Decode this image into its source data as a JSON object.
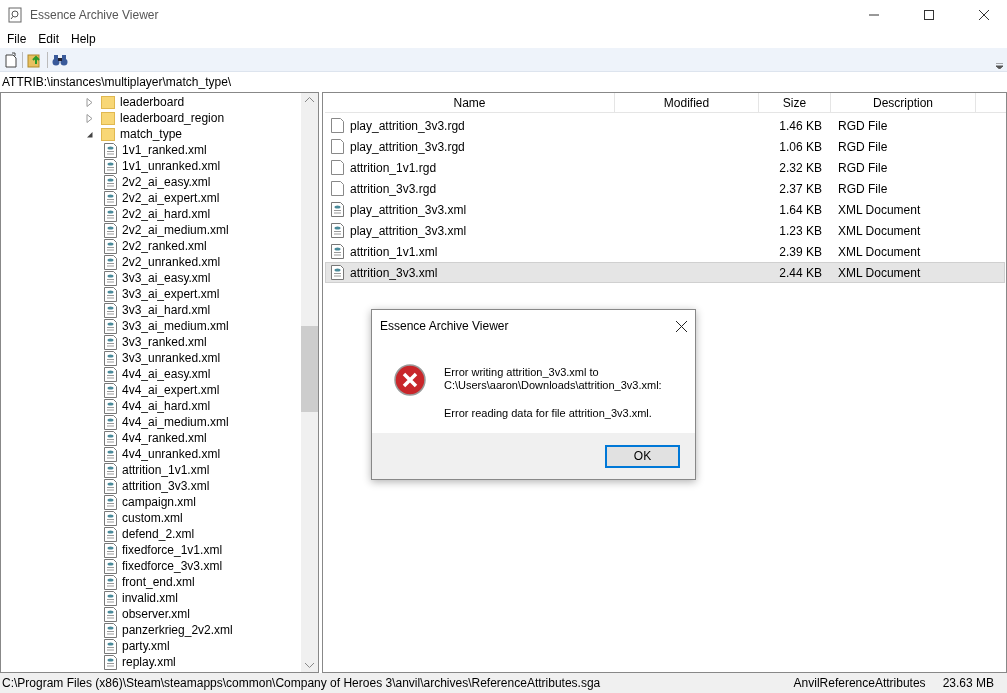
{
  "window": {
    "title": "Essence Archive Viewer"
  },
  "menu": [
    "File",
    "Edit",
    "Help"
  ],
  "address": "ATTRIB:\\instances\\multiplayer\\match_type\\",
  "tree": [
    {
      "label": "leaderboard",
      "kind": "folder",
      "expanded": false
    },
    {
      "label": "leaderboard_region",
      "kind": "folder",
      "expanded": false
    },
    {
      "label": "match_type",
      "kind": "folder",
      "expanded": true,
      "children": [
        {
          "label": "1v1_ranked.xml",
          "kind": "file"
        },
        {
          "label": "1v1_unranked.xml",
          "kind": "file"
        },
        {
          "label": "2v2_ai_easy.xml",
          "kind": "file"
        },
        {
          "label": "2v2_ai_expert.xml",
          "kind": "file"
        },
        {
          "label": "2v2_ai_hard.xml",
          "kind": "file"
        },
        {
          "label": "2v2_ai_medium.xml",
          "kind": "file"
        },
        {
          "label": "2v2_ranked.xml",
          "kind": "file"
        },
        {
          "label": "2v2_unranked.xml",
          "kind": "file"
        },
        {
          "label": "3v3_ai_easy.xml",
          "kind": "file"
        },
        {
          "label": "3v3_ai_expert.xml",
          "kind": "file"
        },
        {
          "label": "3v3_ai_hard.xml",
          "kind": "file"
        },
        {
          "label": "3v3_ai_medium.xml",
          "kind": "file"
        },
        {
          "label": "3v3_ranked.xml",
          "kind": "file"
        },
        {
          "label": "3v3_unranked.xml",
          "kind": "file"
        },
        {
          "label": "4v4_ai_easy.xml",
          "kind": "file"
        },
        {
          "label": "4v4_ai_expert.xml",
          "kind": "file"
        },
        {
          "label": "4v4_ai_hard.xml",
          "kind": "file"
        },
        {
          "label": "4v4_ai_medium.xml",
          "kind": "file"
        },
        {
          "label": "4v4_ranked.xml",
          "kind": "file"
        },
        {
          "label": "4v4_unranked.xml",
          "kind": "file"
        },
        {
          "label": "attrition_1v1.xml",
          "kind": "file"
        },
        {
          "label": "attrition_3v3.xml",
          "kind": "file"
        },
        {
          "label": "campaign.xml",
          "kind": "file"
        },
        {
          "label": "custom.xml",
          "kind": "file"
        },
        {
          "label": "defend_2.xml",
          "kind": "file"
        },
        {
          "label": "fixedforce_1v1.xml",
          "kind": "file"
        },
        {
          "label": "fixedforce_3v3.xml",
          "kind": "file"
        },
        {
          "label": "front_end.xml",
          "kind": "file"
        },
        {
          "label": "invalid.xml",
          "kind": "file"
        },
        {
          "label": "observer.xml",
          "kind": "file"
        },
        {
          "label": "panzerkrieg_2v2.xml",
          "kind": "file"
        },
        {
          "label": "party.xml",
          "kind": "file"
        },
        {
          "label": "replay.xml",
          "kind": "file"
        }
      ]
    }
  ],
  "file_list": {
    "columns": [
      "Name",
      "Modified",
      "Size",
      "Description"
    ],
    "rows": [
      {
        "name": "play_attrition_3v3.rgd",
        "kind": "rgd",
        "size": "1.46 KB",
        "description": "RGD File",
        "selected": false
      },
      {
        "name": "play_attrition_3v3.rgd",
        "kind": "rgd",
        "size": "1.06 KB",
        "description": "RGD File",
        "selected": false
      },
      {
        "name": "attrition_1v1.rgd",
        "kind": "rgd",
        "size": "2.32 KB",
        "description": "RGD File",
        "selected": false
      },
      {
        "name": "attrition_3v3.rgd",
        "kind": "rgd",
        "size": "2.37 KB",
        "description": "RGD File",
        "selected": false
      },
      {
        "name": "play_attrition_3v3.xml",
        "kind": "xml",
        "size": "1.64 KB",
        "description": "XML Document",
        "selected": false
      },
      {
        "name": "play_attrition_3v3.xml",
        "kind": "xml",
        "size": "1.23 KB",
        "description": "XML Document",
        "selected": false
      },
      {
        "name": "attrition_1v1.xml",
        "kind": "xml",
        "size": "2.39 KB",
        "description": "XML Document",
        "selected": false
      },
      {
        "name": "attrition_3v3.xml",
        "kind": "xml",
        "size": "2.44 KB",
        "description": "XML Document",
        "selected": true
      }
    ]
  },
  "dialog": {
    "title": "Essence Archive Viewer",
    "message_lines": [
      "Error writing attrition_3v3.xml to",
      "C:\\Users\\aaron\\Downloads\\attrition_3v3.xml:"
    ],
    "detail": "Error reading data for file attrition_3v3.xml.",
    "button": "OK"
  },
  "status_bar": {
    "path": "C:\\Program Files (x86)\\Steam\\steamapps\\common\\Company of Heroes 3\\anvil\\archives\\ReferenceAttributes.sga",
    "archive": "AnvilReferenceAttributes",
    "size": "23.63 MB"
  }
}
